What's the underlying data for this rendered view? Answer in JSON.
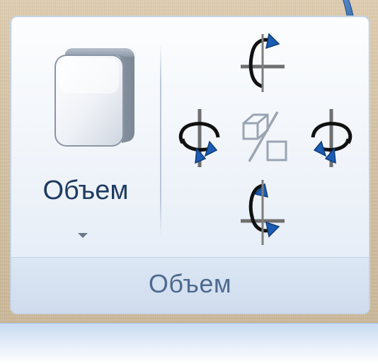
{
  "ribbon": {
    "group_label": "Объем",
    "volume_button": {
      "label": "Объем",
      "icon": "volume-cube-icon",
      "has_dropdown": true
    },
    "tools": [
      {
        "name": "tilt-up",
        "icon": "rotate-tilt-up-icon"
      },
      {
        "name": "tilt-left",
        "icon": "rotate-tilt-left-icon"
      },
      {
        "name": "toggle-3d",
        "icon": "toggle-3d-icon"
      },
      {
        "name": "tilt-right",
        "icon": "rotate-tilt-right-icon"
      },
      {
        "name": "tilt-down",
        "icon": "rotate-tilt-down-icon"
      }
    ]
  },
  "colors": {
    "accent_arrow": "#2f67a8",
    "label_text": "#1f3b64",
    "group_label_text": "#4e6a90"
  }
}
